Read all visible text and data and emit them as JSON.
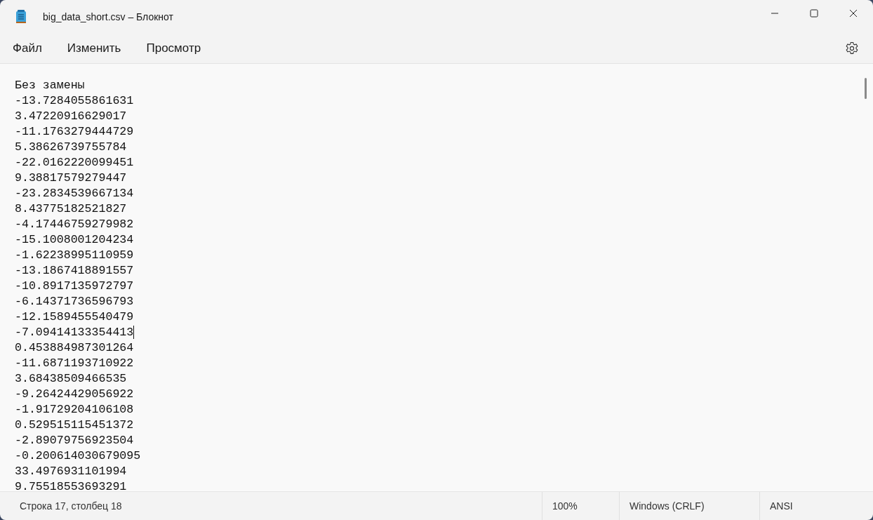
{
  "window": {
    "title": "big_data_short.csv – Блокнот"
  },
  "menu": [
    {
      "label": "Файл"
    },
    {
      "label": "Изменить"
    },
    {
      "label": "Просмотр"
    }
  ],
  "editor": {
    "lines": [
      {
        "text": "Без замены",
        "has_caret": false
      },
      {
        "text": "-13.7284055861631",
        "has_caret": false
      },
      {
        "text": "3.47220916629017",
        "has_caret": false
      },
      {
        "text": "-11.1763279444729",
        "has_caret": false
      },
      {
        "text": "5.38626739755784",
        "has_caret": false
      },
      {
        "text": "-22.0162220099451",
        "has_caret": false
      },
      {
        "text": "9.38817579279447",
        "has_caret": false
      },
      {
        "text": "-23.2834539667134",
        "has_caret": false
      },
      {
        "text": "8.43775182521827",
        "has_caret": false
      },
      {
        "text": "-4.17446759279982",
        "has_caret": false
      },
      {
        "text": "-15.1008001204234",
        "has_caret": false
      },
      {
        "text": "-1.62238995110959",
        "has_caret": false
      },
      {
        "text": "-13.1867418891557",
        "has_caret": false
      },
      {
        "text": "-10.8917135972797",
        "has_caret": false
      },
      {
        "text": "-6.14371736596793",
        "has_caret": false
      },
      {
        "text": "-12.1589455540479",
        "has_caret": false
      },
      {
        "text": "-7.09414133354413",
        "has_caret": true
      },
      {
        "text": "0.453884987301264",
        "has_caret": false
      },
      {
        "text": "-11.6871193710922",
        "has_caret": false
      },
      {
        "text": "3.68438509466535",
        "has_caret": false
      },
      {
        "text": "-9.26424429056922",
        "has_caret": false
      },
      {
        "text": "-1.91729204106108",
        "has_caret": false
      },
      {
        "text": "0.529515115451372",
        "has_caret": false
      },
      {
        "text": "-2.89079756923504",
        "has_caret": false
      },
      {
        "text": "-0.200614030679095",
        "has_caret": false
      },
      {
        "text": "33.4976931101994",
        "has_caret": false
      },
      {
        "text": "9.75518553693291",
        "has_caret": false
      }
    ]
  },
  "status_bar": {
    "position": "Строка 17, столбец 18",
    "zoom": "100%",
    "line_endings": "Windows (CRLF)",
    "encoding": "ANSI"
  }
}
